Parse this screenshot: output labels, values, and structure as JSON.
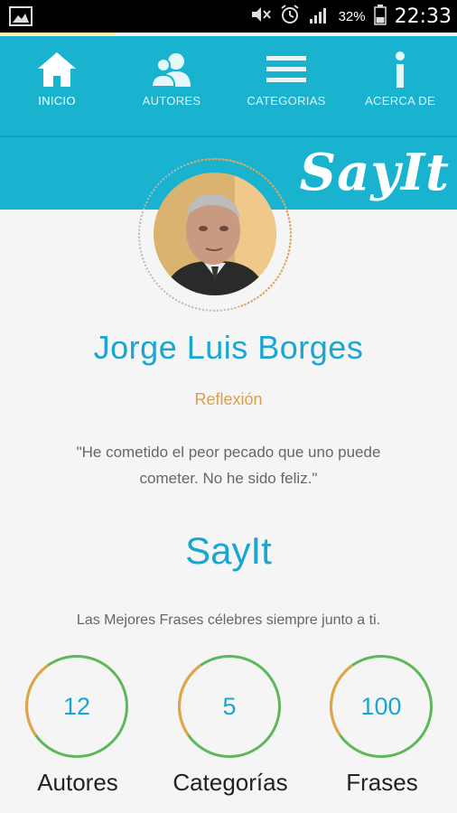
{
  "status_bar": {
    "battery_percent": "32%",
    "time": "22:33",
    "icons": [
      "gallery-icon",
      "mute-icon",
      "alarm-icon",
      "signal-icon",
      "battery-icon"
    ]
  },
  "nav": {
    "items": [
      {
        "label": "INICIO",
        "icon": "home-icon",
        "active": true
      },
      {
        "label": "AUTORES",
        "icon": "users-icon",
        "active": false
      },
      {
        "label": "CATEGORIAS",
        "icon": "menu-icon",
        "active": false
      },
      {
        "label": "ACERCA DE",
        "icon": "info-icon",
        "active": false
      }
    ]
  },
  "brand": {
    "logo_text": "SayIt"
  },
  "featured": {
    "author": "Jorge Luis Borges",
    "category": "Reflexión",
    "quote": "\"He cometido el peor pecado que uno puede cometer. No he sido feliz.\""
  },
  "app": {
    "title": "SayIt",
    "tagline": "Las Mejores Frases célebres siempre junto a ti."
  },
  "stats": [
    {
      "value": "12",
      "label": "Autores"
    },
    {
      "value": "5",
      "label": "Categorías"
    },
    {
      "value": "100",
      "label": "Frases"
    }
  ],
  "colors": {
    "primary": "#1ab3cf",
    "accent_text": "#1aa6d0",
    "category": "#d9a04f",
    "ring_green": "#5db85a",
    "ring_orange": "#e3a443"
  }
}
